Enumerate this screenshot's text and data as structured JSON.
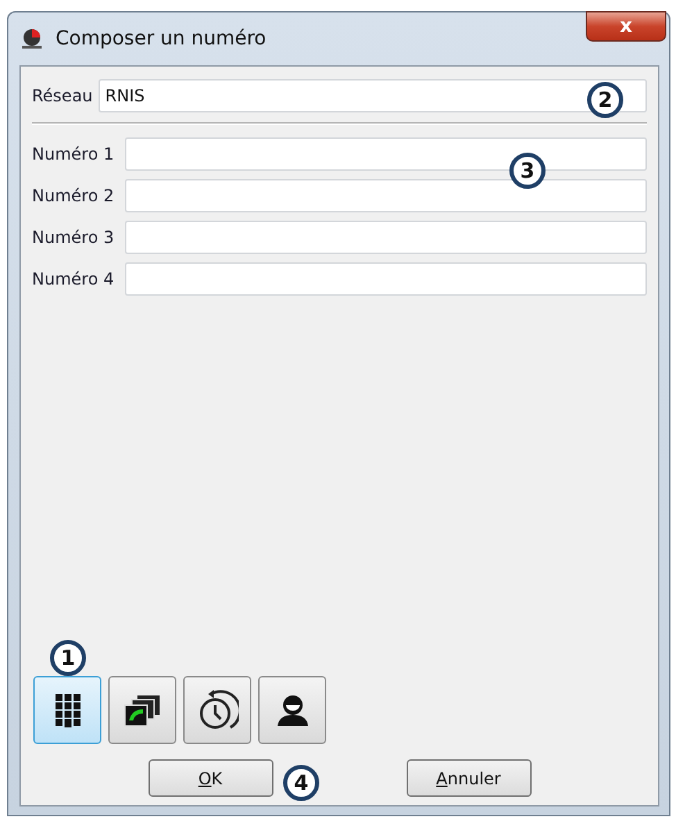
{
  "window": {
    "title": "Composer un numéro",
    "close": "x"
  },
  "network": {
    "label": "Réseau",
    "value": "RNIS"
  },
  "numbers": [
    {
      "label": "Numéro 1"
    },
    {
      "label": "Numéro 2"
    },
    {
      "label": "Numéro 3"
    },
    {
      "label": "Numéro 4"
    }
  ],
  "modes": [
    {
      "kind": "keypad",
      "selected": true
    },
    {
      "kind": "calls",
      "selected": false
    },
    {
      "kind": "history",
      "selected": false
    },
    {
      "kind": "contact",
      "selected": false
    }
  ],
  "buttons": [
    {
      "label": "OK"
    },
    {
      "label": "Annuler"
    }
  ],
  "callouts": [
    "1",
    "2",
    "3",
    "4"
  ]
}
